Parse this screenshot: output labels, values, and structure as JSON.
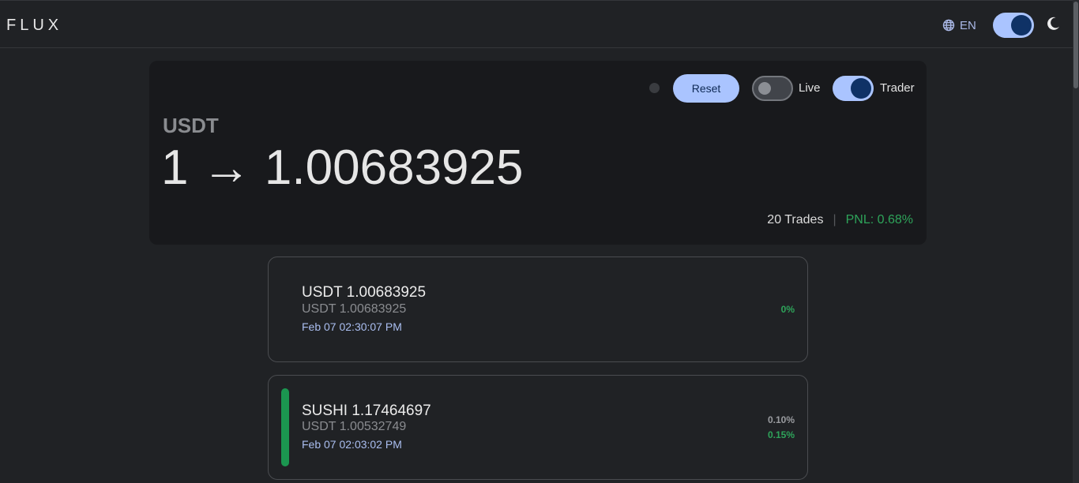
{
  "header": {
    "logo": "FLUX",
    "language": "EN",
    "icons": {
      "language": "globe-icon",
      "theme": "moon-icon"
    }
  },
  "hero": {
    "reset_label": "Reset",
    "live_label": "Live",
    "live_on": false,
    "trader_label": "Trader",
    "trader_on": true,
    "currency": "USDT",
    "value": "1 → 1.00683925",
    "trades": "20 Trades",
    "separator": "|",
    "pnl": "PNL: 0.68%"
  },
  "trades": [
    {
      "amount": "USDT 1.00683925",
      "sub": "USDT 1.00683925",
      "date": "Feb 07 02:30:07 PM",
      "pct_primary": "0%",
      "pct_secondary": "",
      "indicator": false
    },
    {
      "amount": "SUSHI 1.17464697",
      "sub": "USDT 1.00532749",
      "date": "Feb 07 02:03:02 PM",
      "pct_primary": "0.10%",
      "pct_secondary": "0.15%",
      "indicator": true
    }
  ],
  "colors": {
    "accent": "#aac4ff",
    "positive": "#2ea45a",
    "background": "#202225"
  }
}
